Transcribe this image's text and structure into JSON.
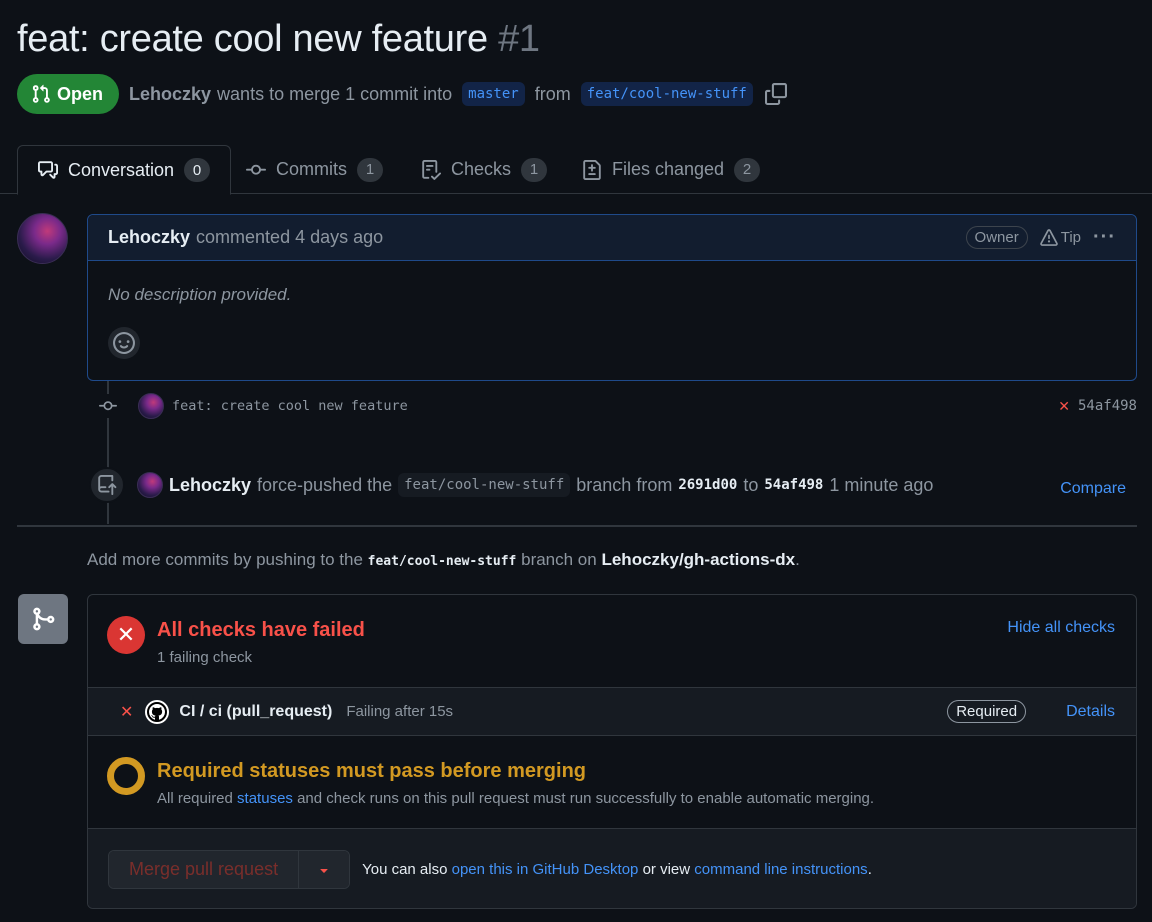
{
  "pr": {
    "title": "feat: create cool new feature",
    "number": "#1",
    "state": "Open",
    "author": "Lehoczky",
    "merge_text": "wants to merge 1 commit into",
    "base_branch": "master",
    "from_word": "from",
    "head_branch": "feat/cool-new-stuff"
  },
  "tabs": [
    {
      "label": "Conversation",
      "count": "0",
      "icon": "comment-discussion-icon"
    },
    {
      "label": "Commits",
      "count": "1",
      "icon": "git-commit-icon"
    },
    {
      "label": "Checks",
      "count": "1",
      "icon": "checklist-icon"
    },
    {
      "label": "Files changed",
      "count": "2",
      "icon": "file-diff-icon"
    }
  ],
  "comment": {
    "author": "Lehoczky",
    "meta": "commented 4 days ago",
    "badge": "Owner",
    "tip": "Tip",
    "more": "···",
    "body": "No description provided."
  },
  "timeline": {
    "commit_message": "feat: create cool new feature",
    "commit_sha": "54af498",
    "commit_status": "✕",
    "push_author": "Lehoczky",
    "push_text1": "force-pushed the",
    "push_branch": "feat/cool-new-stuff",
    "push_text2": "branch from",
    "push_from": "2691d00",
    "push_to_word": "to",
    "push_to": "54af498",
    "push_time": "1 minute ago",
    "compare": "Compare"
  },
  "hint": {
    "prefix": "Add more commits by pushing to the",
    "branch": "feat/cool-new-stuff",
    "middle": "branch on",
    "repo": "Lehoczky/gh-actions-dx",
    "suffix": "."
  },
  "checks": {
    "title": "All checks have failed",
    "subtitle": "1 failing check",
    "hide": "Hide all checks",
    "items": [
      {
        "name": "CI / ci (pull_request)",
        "status": "Failing after 15s",
        "badge": "Required",
        "details": "Details"
      }
    ]
  },
  "required": {
    "title": "Required statuses must pass before merging",
    "text1": "All required",
    "link": "statuses",
    "text2": "and check runs on this pull request must run successfully to enable automatic merging."
  },
  "merge": {
    "button": "Merge pull request",
    "note1": "You can also",
    "link1": "open this in GitHub Desktop",
    "note2": "or view",
    "link2": "command line instructions",
    "note3": "."
  },
  "colors": {
    "open": "#238636",
    "danger": "#f85149",
    "attention": "#d29922",
    "accent": "#4493f8"
  }
}
